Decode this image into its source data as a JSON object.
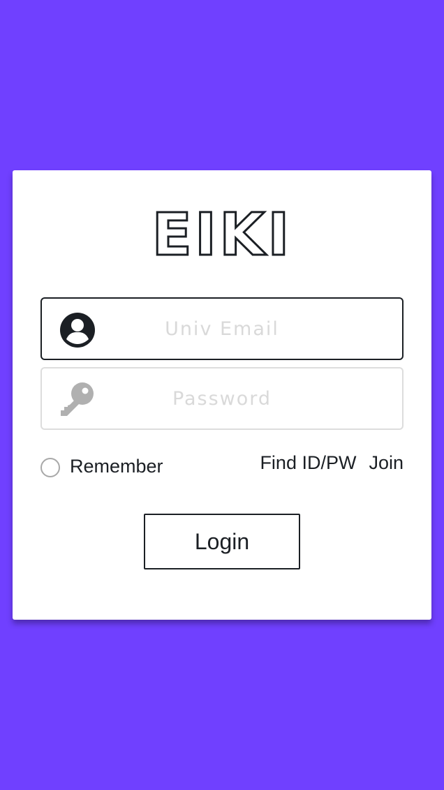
{
  "app": {
    "logo_text": "EIKI"
  },
  "form": {
    "email": {
      "placeholder": "Univ Email",
      "value": "",
      "icon": "user-avatar-icon"
    },
    "password": {
      "placeholder": "Password",
      "value": "",
      "icon": "key-icon"
    },
    "remember_label": "Remember",
    "remember_checked": false,
    "find_link": "Find ID/PW",
    "join_link": "Join",
    "login_button": "Login"
  },
  "colors": {
    "background": "#7040ff",
    "card": "#ffffff",
    "text_dark": "#1b1f24",
    "placeholder": "#d9d9d9",
    "inactive_icon": "#b0b0b0"
  }
}
